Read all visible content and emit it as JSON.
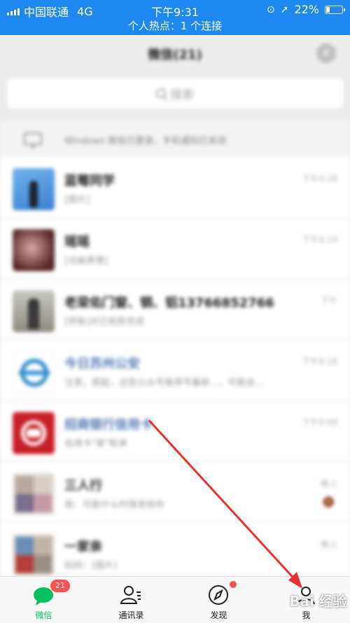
{
  "status": {
    "carrier": "中国联通",
    "network": "4G",
    "time": "下午9:31",
    "battery": "22%",
    "hotspot": "个人热点：1 个连接"
  },
  "header": {
    "title": "微信(21)"
  },
  "search": {
    "placeholder": "搜索"
  },
  "notice": {
    "text": "Windows 微信已登录，手机通知已关闭"
  },
  "chats": [
    {
      "name": "蓝莓同学",
      "msg": "[图片]",
      "time": "下午9:28",
      "blue": false
    },
    {
      "name": "瑶瑶",
      "msg": "[动画表情]",
      "time": "下午9:19",
      "blue": false
    },
    {
      "name": "老梁佑门窗、钢、铝13766852766",
      "msg": "[转账]对已收款完成",
      "time": "下午",
      "blue": false
    },
    {
      "name": "今日苏州公安",
      "msg": "注意，提起，这些公众号推荐号最新...，可能会...",
      "time": "下午9:18",
      "blue": true
    },
    {
      "name": "招商银行信用卡",
      "msg": "信用卡\"掌\"账单",
      "time": "下午9:08",
      "blue": true
    },
    {
      "name": "三人行",
      "msg": "我：可能什么时候发给你",
      "time": "晚上",
      "blue": false
    },
    {
      "name": "一家亲",
      "msg": "妈妈：[图片]",
      "time": "晚上",
      "blue": false
    }
  ],
  "tabs": [
    {
      "label": "微信",
      "badge": "21"
    },
    {
      "label": "通讯录"
    },
    {
      "label": "发现"
    },
    {
      "label": "我"
    }
  ],
  "watermark": "Bai 经验",
  "colors": {
    "statusbar": "#1e87f0",
    "accent": "#07c160",
    "badge": "#fa5151",
    "arrow": "#e8322f"
  }
}
